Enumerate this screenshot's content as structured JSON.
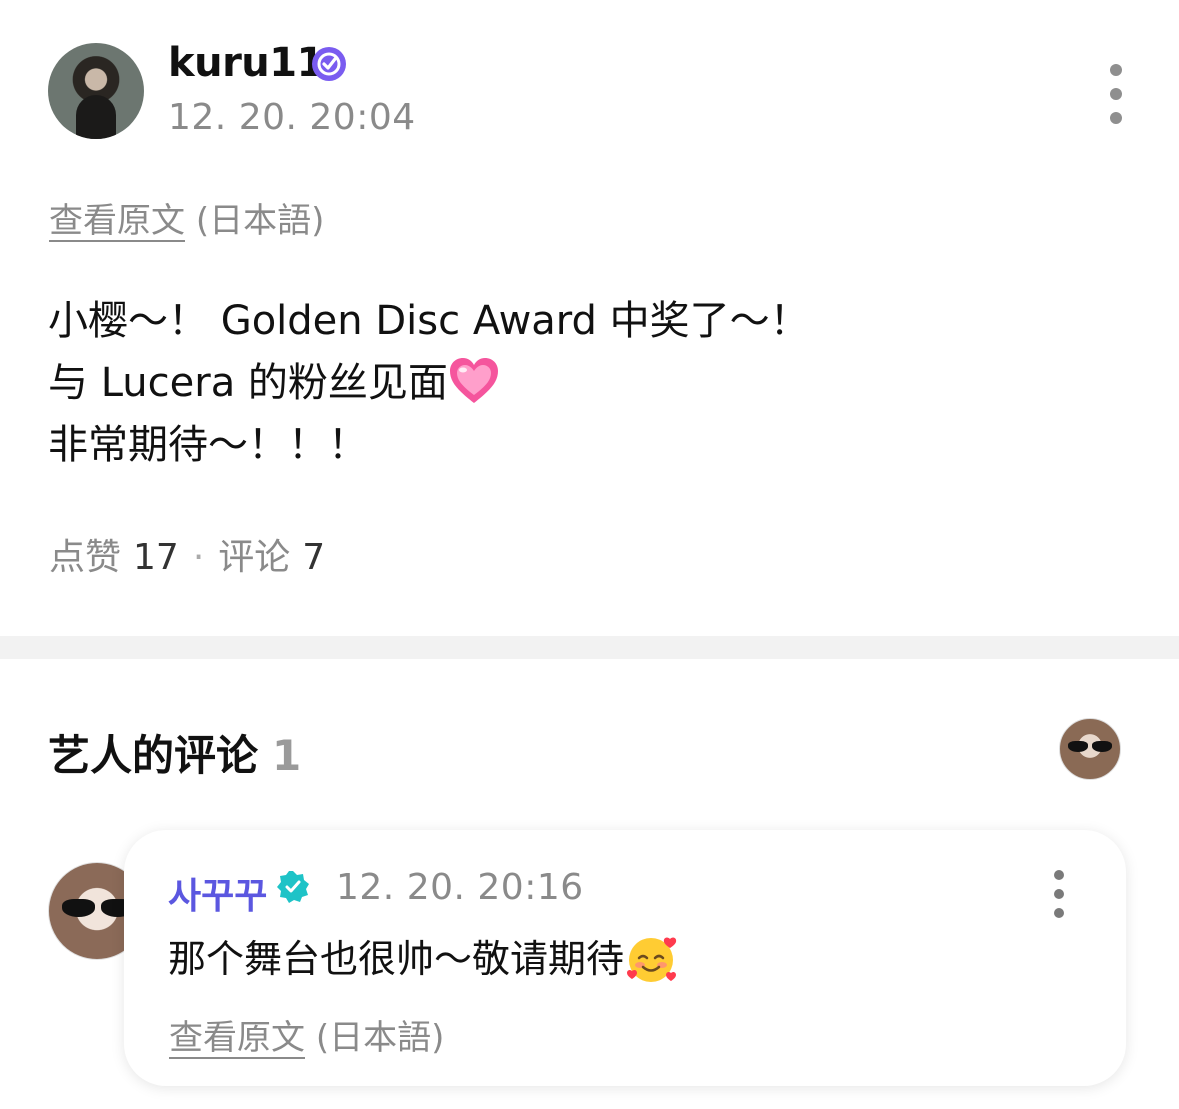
{
  "post": {
    "author": "kuru11",
    "timestamp": "12. 20. 20:04",
    "translate_link": "查看原文",
    "translate_lang": "(日本語)",
    "body_lines": [
      "小樱～！ Golden Disc Award 中奖了～！",
      "与 Lucera 的粉丝见面",
      "非常期待～！！！"
    ],
    "likes_label": "点赞",
    "likes_count": "17",
    "comments_label": "评论",
    "comments_count": "7",
    "separator": "·"
  },
  "artist_comments": {
    "title": "艺人的评论",
    "count": "1",
    "comment": {
      "author": "사꾸꾸",
      "timestamp": "12. 20. 20:16",
      "text": "那个舞台也很帅～敬请期待",
      "translate_link": "查看原文",
      "translate_lang": "(日本語)"
    }
  },
  "colors": {
    "verified_badge": "#7a5cf0",
    "artist_check": "#1ec3c7",
    "artist_name": "#5b57e0",
    "muted_text": "#8a8a8a"
  },
  "icons": {
    "verified": "verified-badge-icon",
    "artist_check": "artist-verified-icon",
    "more": "more-vertical-icon",
    "heart_emoji": "pink-heart-emoji",
    "face_emoji": "smiling-face-with-hearts-emoji"
  }
}
